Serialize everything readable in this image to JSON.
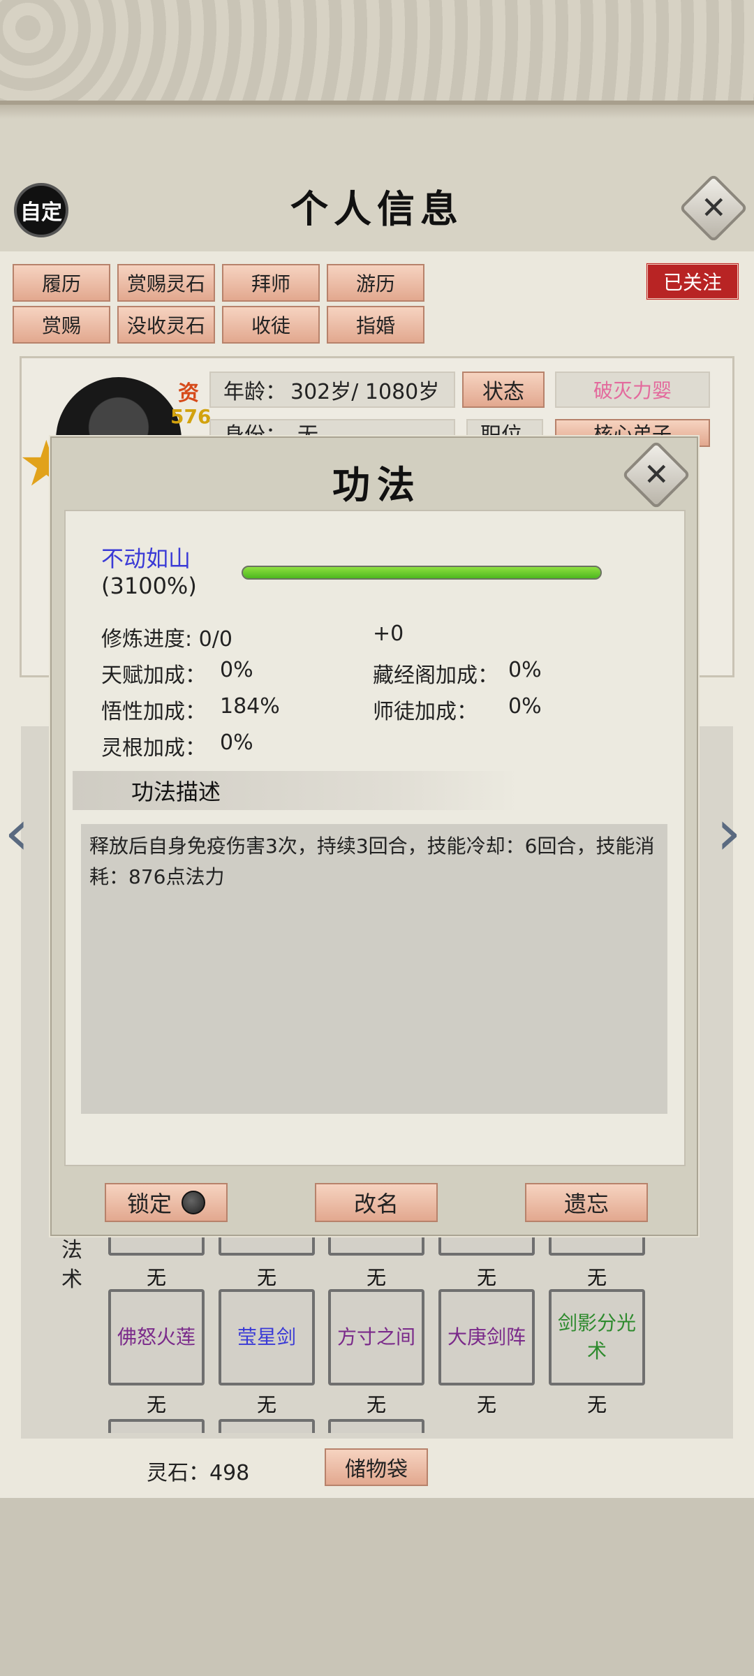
{
  "header": {
    "title": "个人信息",
    "custom_label": "自定",
    "close_glyph": "✕"
  },
  "actions": {
    "row1": [
      "履历",
      "赏赐灵石",
      "拜师",
      "游历"
    ],
    "row2": [
      "赏赐",
      "没收灵石",
      "收徒",
      "指婚"
    ],
    "followed_label": "已关注"
  },
  "profile": {
    "zi_label": "资",
    "zi_value": "576",
    "age_label": "年龄：",
    "age_value": "302岁/ 1080岁",
    "status_button": "状态",
    "realm": "破灭力婴",
    "identity_label": "身份：",
    "identity_value": "无",
    "duty_label": "职位",
    "duty_value": "核心弟子"
  },
  "modal": {
    "title": "功法",
    "close_glyph": "✕",
    "skill_name": "不动如山",
    "skill_percent": "(3100%)",
    "progress_fraction": 1.0,
    "stats": {
      "progress_label": "修炼进度: 0/0",
      "progress_bonus": "+0",
      "talent_label": "天赋加成：",
      "talent_value": "0%",
      "library_label": "藏经阁加成：",
      "library_value": "0%",
      "insight_label": "悟性加成：",
      "insight_value": "184%",
      "master_label": "师徒加成：",
      "master_value": "0%",
      "root_label": "灵根加成：",
      "root_value": "0%"
    },
    "desc_header": "功法描述",
    "description": "释放后自身免疫伤害3次，持续3回合，技能冷却：6回合，技能消耗：876点法力",
    "buttons": {
      "lock": "锁定",
      "rename": "改名",
      "forget": "遗忘"
    }
  },
  "skills": {
    "section_label_1": "法",
    "section_label_2": "术",
    "none_label": "无",
    "slots": [
      {
        "name": "佛怒火莲",
        "color": "#7a2a8a"
      },
      {
        "name": "莹星剑",
        "color": "#3a3ad6"
      },
      {
        "name": "方寸之间",
        "color": "#7a2a8a"
      },
      {
        "name": "大庚剑阵",
        "color": "#7a2a8a"
      },
      {
        "name": "剑影分光术",
        "color": "#2d8a2d"
      }
    ]
  },
  "footer": {
    "stone_label": "灵石：498",
    "bag_button": "储物袋"
  },
  "nav": {
    "left_arrow": "‹",
    "right_arrow": "›"
  }
}
